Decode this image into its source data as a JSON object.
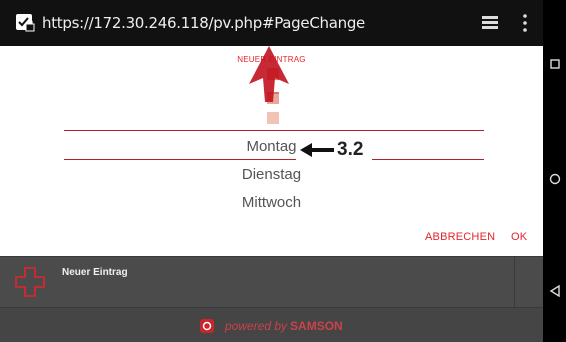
{
  "browser": {
    "url": "https://172.30.246.118/pv.php#PageChange"
  },
  "dialog": {
    "title": "NEUER EINTRAG",
    "options": [
      "Montag",
      "Dienstag",
      "Mittwoch"
    ],
    "cancel_label": "ABBRECHEN",
    "ok_label": "OK"
  },
  "annotation": {
    "label": "3.2"
  },
  "list": {
    "item_label": "Neuer Eintrag"
  },
  "footer": {
    "powered_by": "powered by",
    "brand": "SAMSON"
  },
  "colors": {
    "accent": "#e3242b",
    "divider": "#b3222a",
    "background": "#4a4a4a"
  },
  "icons": [
    "site-security-icon",
    "tabs-icon",
    "overflow-menu-icon",
    "add-cross-icon",
    "samson-logo-icon",
    "recent-apps-icon",
    "home-icon",
    "back-icon"
  ]
}
